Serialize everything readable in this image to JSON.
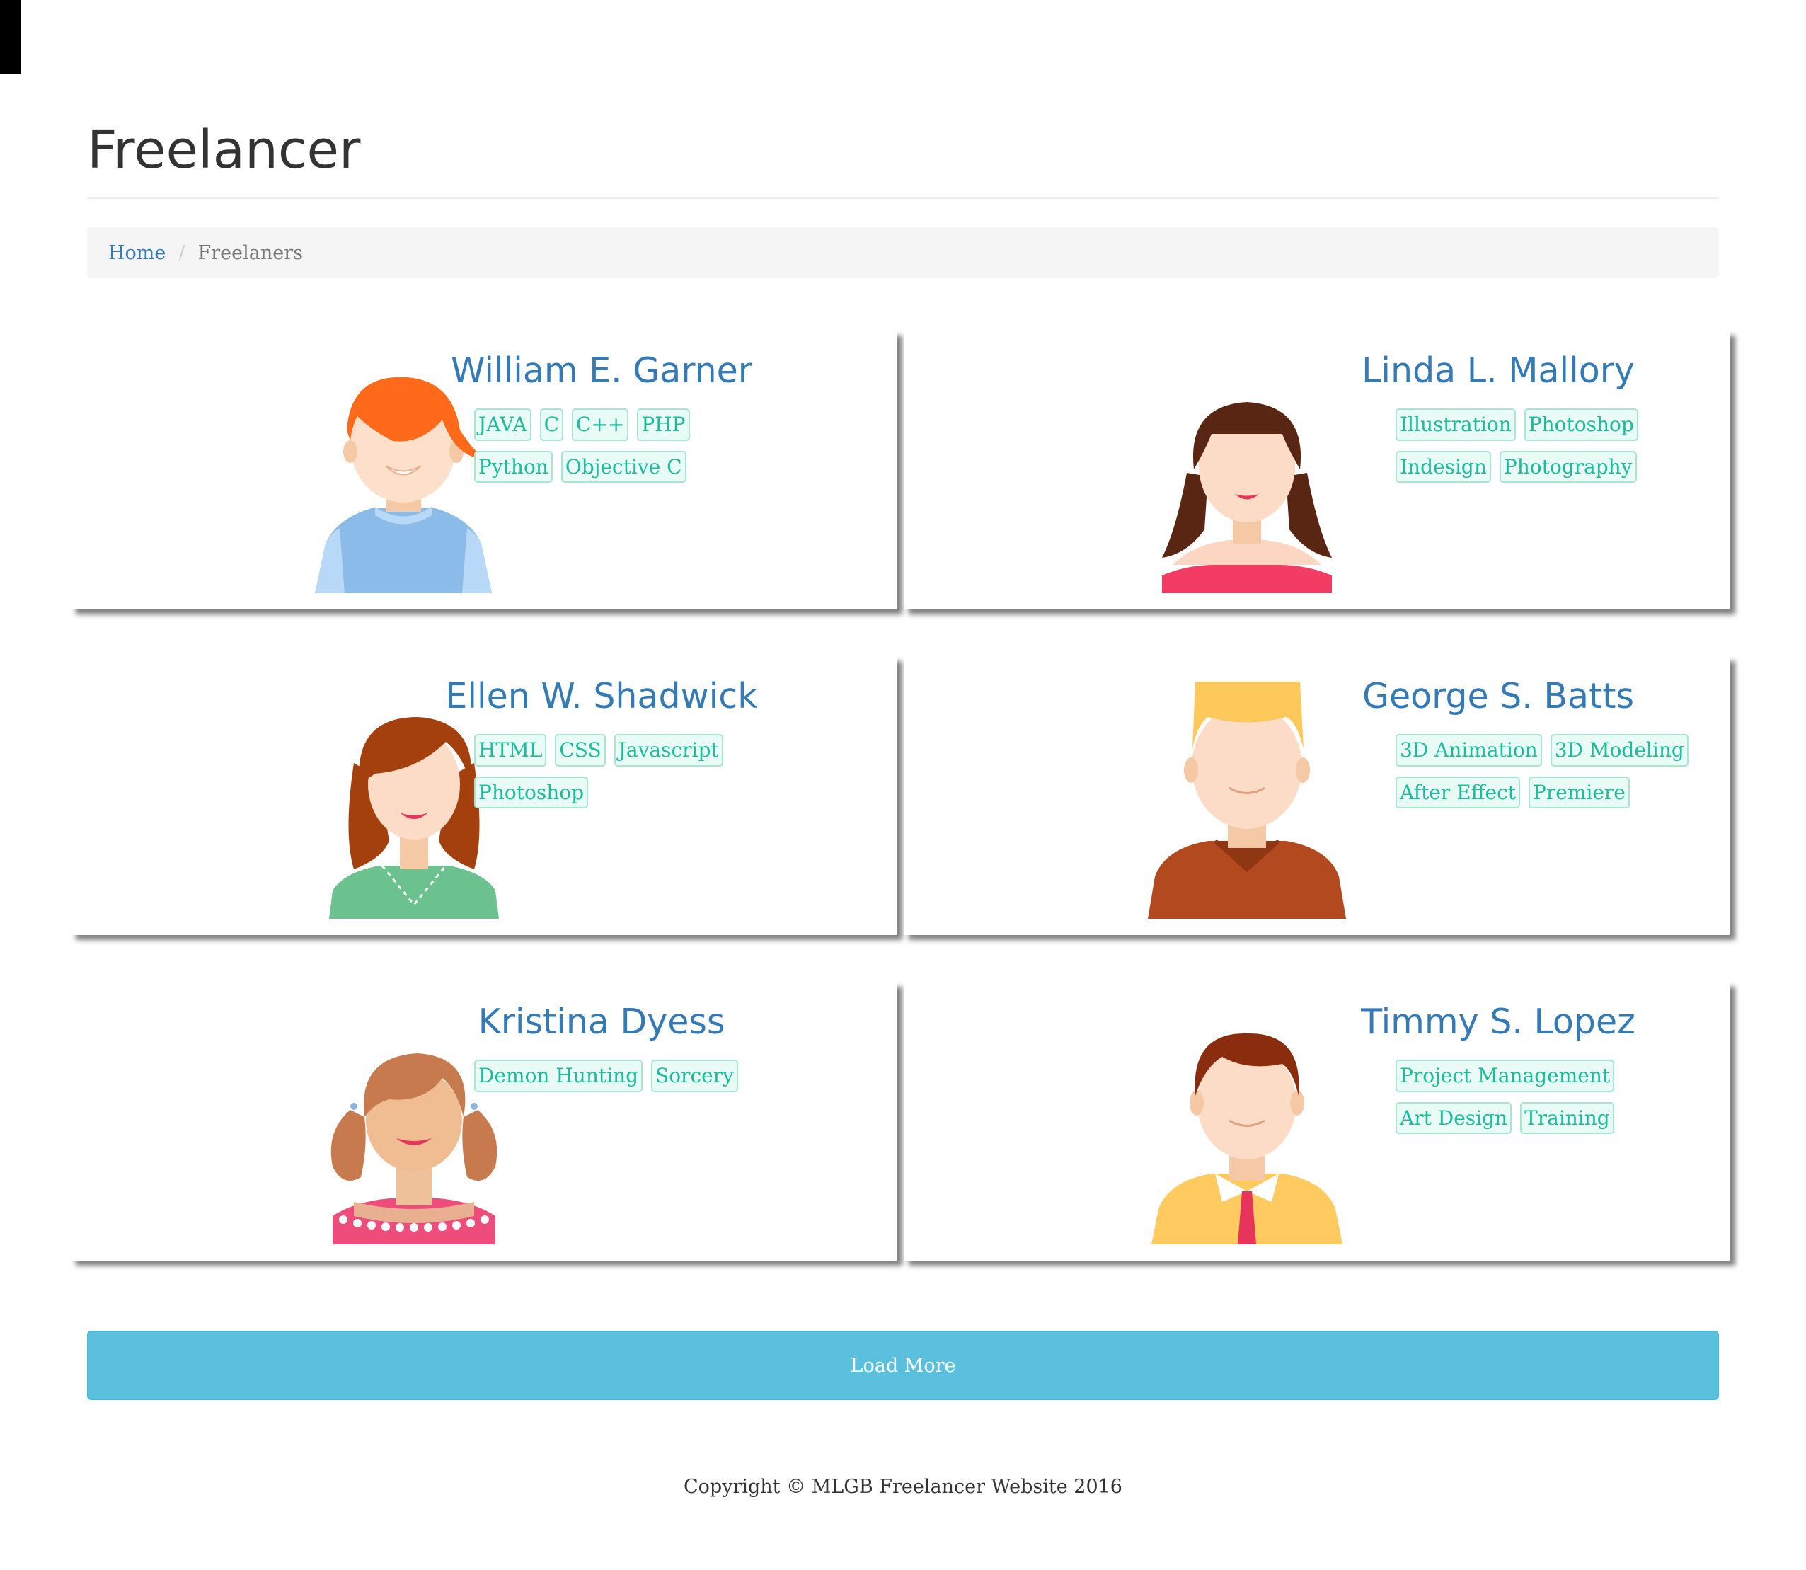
{
  "page": {
    "title": "Freelancer"
  },
  "breadcrumb": {
    "home": "Home",
    "separator": "/",
    "current": "Freelaners"
  },
  "freelancers": [
    {
      "name": "William E. Garner",
      "avatar": "boy-orange-hair-avatar",
      "skills": [
        "JAVA",
        "C",
        "C++",
        "PHP",
        "Python",
        "Objective C"
      ]
    },
    {
      "name": "Linda L. Mallory",
      "avatar": "woman-dark-hair-avatar",
      "skills": [
        "Illustration",
        "Photoshop",
        "Indesign",
        "Photography"
      ]
    },
    {
      "name": "Ellen W. Shadwick",
      "avatar": "woman-red-hair-avatar",
      "skills": [
        "HTML",
        "CSS",
        "Javascript",
        "Photoshop"
      ]
    },
    {
      "name": "George S. Batts",
      "avatar": "man-blond-hair-avatar",
      "skills": [
        "3D Animation",
        "3D Modeling",
        "After Effect",
        "Premiere"
      ]
    },
    {
      "name": "Kristina Dyess",
      "avatar": "girl-pigtails-avatar",
      "skills": [
        "Demon Hunting",
        "Sorcery"
      ]
    },
    {
      "name": "Timmy S. Lopez",
      "avatar": "man-tie-avatar",
      "skills": [
        "Project Management",
        "Art Design",
        "Training"
      ]
    }
  ],
  "actions": {
    "load_more": "Load More"
  },
  "footer": {
    "copyright": "Copyright © MLGB Freelancer Website 2016"
  },
  "colors": {
    "link": "#337ab7",
    "tag_text": "#1abc9c",
    "tag_bg": "#e9fbf5",
    "button": "#5bc0de"
  }
}
